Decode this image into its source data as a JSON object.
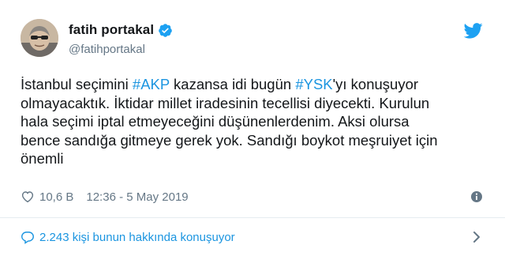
{
  "author": {
    "display_name": "fatih portakal",
    "handle": "@fatihportakal",
    "verified_icon": "verified-badge-icon",
    "avatar_icon": "avatar"
  },
  "brand_icon": "twitter-bird-icon",
  "tweet": {
    "lines": [
      [
        {
          "text": "İstanbul seçimini ",
          "type": "text"
        },
        {
          "text": "#AKP",
          "type": "hashtag"
        },
        {
          "text": " kazansa idi bugün ",
          "type": "text"
        },
        {
          "text": "#YSK",
          "type": "hashtag"
        },
        {
          "text": "'yı konuşuyor",
          "type": "text"
        }
      ],
      [
        {
          "text": "olmayacaktık. İktidar millet iradesinin tecellisi diyecekti. Kurulun",
          "type": "text"
        }
      ],
      [
        {
          "text": "hala seçimi iptal etmeyeceğini düşünenlerdenim. Aksi olursa",
          "type": "text"
        }
      ],
      [
        {
          "text": "bence sandığa gitmeye gerek yok. Sandığı boykot meşruiyet için",
          "type": "text"
        }
      ],
      [
        {
          "text": "önemli",
          "type": "text"
        }
      ]
    ]
  },
  "meta": {
    "likes": "10,6 B",
    "timestamp": "12:36 - 5 May 2019",
    "heart_icon": "heart-icon",
    "info_icon": "info-icon"
  },
  "footer": {
    "conversation_label": "2.243 kişi bunun hakkında konuşuyor",
    "bubble_icon": "comment-bubble-icon",
    "chevron_icon": "chevron-right-icon"
  },
  "colors": {
    "link": "#1b95e0",
    "secondary_text": "#657786",
    "primary_text": "#14171a",
    "divider": "#e6ecf0"
  }
}
